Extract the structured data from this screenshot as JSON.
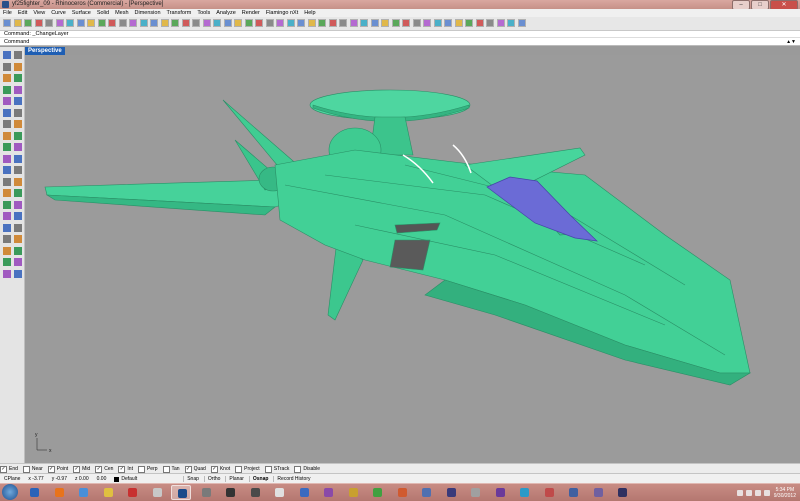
{
  "window": {
    "title": "yf25fighter_09 - Rhinoceros (Commercial) - [Perspective]",
    "buttons": [
      "–",
      "□",
      "✕"
    ]
  },
  "menu": [
    "File",
    "Edit",
    "View",
    "Curve",
    "Surface",
    "Solid",
    "Mesh",
    "Dimension",
    "Transform",
    "Tools",
    "Analyze",
    "Render",
    "Flamingo nXt",
    "Help"
  ],
  "command": {
    "history": "Command: _ChangeLayer",
    "prompt": "Command"
  },
  "viewport": {
    "tab": "Perspective",
    "axis_x": "x",
    "axis_y": "y",
    "model_color": "#3fcf95",
    "canopy_color": "#6b6bd6",
    "background": "#9b9b9b"
  },
  "osnap": [
    {
      "label": "End",
      "checked": true
    },
    {
      "label": "Near",
      "checked": false
    },
    {
      "label": "Point",
      "checked": true
    },
    {
      "label": "Mid",
      "checked": true
    },
    {
      "label": "Cen",
      "checked": true
    },
    {
      "label": "Int",
      "checked": true
    },
    {
      "label": "Perp",
      "checked": false
    },
    {
      "label": "Tan",
      "checked": false
    },
    {
      "label": "Quad",
      "checked": true
    },
    {
      "label": "Knot",
      "checked": true
    },
    {
      "label": "Project",
      "checked": false
    },
    {
      "label": "STrack",
      "checked": false
    },
    {
      "label": "Disable",
      "checked": false
    }
  ],
  "status": {
    "cplane": "CPlane",
    "x": "x -3.77",
    "y": "y -0.97",
    "z": "z 0.00",
    "dist": "0.00",
    "layer": "Default",
    "panes": [
      "Snap",
      "Ortho",
      "Planar",
      "Osnap",
      "Record History"
    ]
  },
  "taskbar": {
    "time": "5:34 PM",
    "date": "9/30/2012"
  }
}
